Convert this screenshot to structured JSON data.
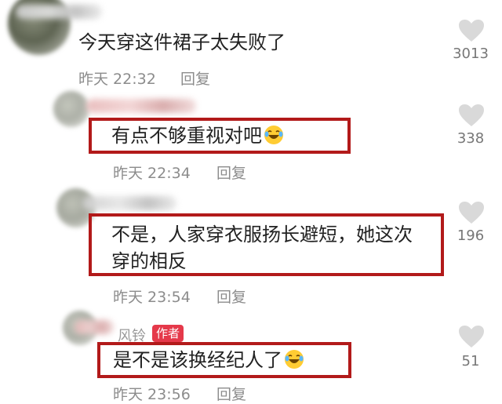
{
  "comments": [
    {
      "text": "今天穿这件裙子太失败了",
      "time": "昨天 22:32",
      "reply": "回复",
      "likes": "3013"
    },
    {
      "text": "有点不够重视对吧",
      "time": "昨天 22:34",
      "reply": "回复",
      "likes": "338",
      "emoji": "laughing-crying-emoji"
    },
    {
      "text_line1": "不是，人家穿衣服扬长避短，她这次",
      "text_line2": "穿的相反",
      "time": "昨天 23:54",
      "reply": "回复",
      "likes": "196"
    },
    {
      "author": "风铃",
      "badge": "作者",
      "text": "是不是该换经纪人了",
      "time": "昨天 23:56",
      "reply": "回复",
      "likes": "51",
      "emoji": "laughing-crying-emoji"
    }
  ],
  "colors": {
    "highlight": "#b21a1a",
    "badge": "#e5394a",
    "meta": "#8c8c8c"
  }
}
